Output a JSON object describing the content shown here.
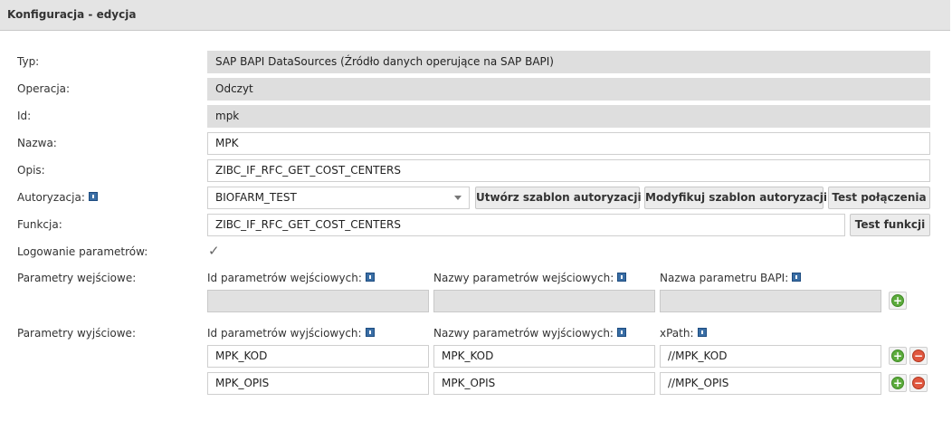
{
  "header": {
    "title": "Konfiguracja - edycja"
  },
  "labels": {
    "typ": "Typ:",
    "operacja": "Operacja:",
    "id": "Id:",
    "nazwa": "Nazwa:",
    "opis": "Opis:",
    "autoryzacja": "Autoryzacja:",
    "funkcja": "Funkcja:",
    "logowanie": "Logowanie parametrów:",
    "param_wej": "Parametry wejściowe:",
    "param_wyj": "Parametry wyjściowe:"
  },
  "values": {
    "typ": "SAP BAPI DataSources (Źródło danych operujące na SAP BAPI)",
    "operacja": "Odczyt",
    "id": "mpk",
    "nazwa": "MPK",
    "opis": "ZIBC_IF_RFC_GET_COST_CENTERS",
    "autoryzacja": "BIOFARM_TEST",
    "funkcja": "ZIBC_IF_RFC_GET_COST_CENTERS"
  },
  "buttons": {
    "create_auth": "Utwórz szablon autoryzacji",
    "modify_auth": "Modyfikuj szablon autoryzacji",
    "test_conn": "Test połączenia",
    "test_func": "Test funkcji"
  },
  "logowanie_checked": true,
  "input_params": {
    "col1": "Id parametrów wejściowych:",
    "col2": "Nazwy parametrów wejściowych:",
    "col3": "Nazwa parametru BAPI:"
  },
  "output_params": {
    "col1": "Id parametrów wyjściowych:",
    "col2": "Nazwy parametrów wyjściowych:",
    "col3": "xPath:",
    "rows": [
      {
        "id": "MPK_KOD",
        "name": "MPK_KOD",
        "xpath": "//MPK_KOD"
      },
      {
        "id": "MPK_OPIS",
        "name": "MPK_OPIS",
        "xpath": "//MPK_OPIS"
      }
    ]
  },
  "icons": {
    "add": "+",
    "remove": "−",
    "check": "✓"
  }
}
